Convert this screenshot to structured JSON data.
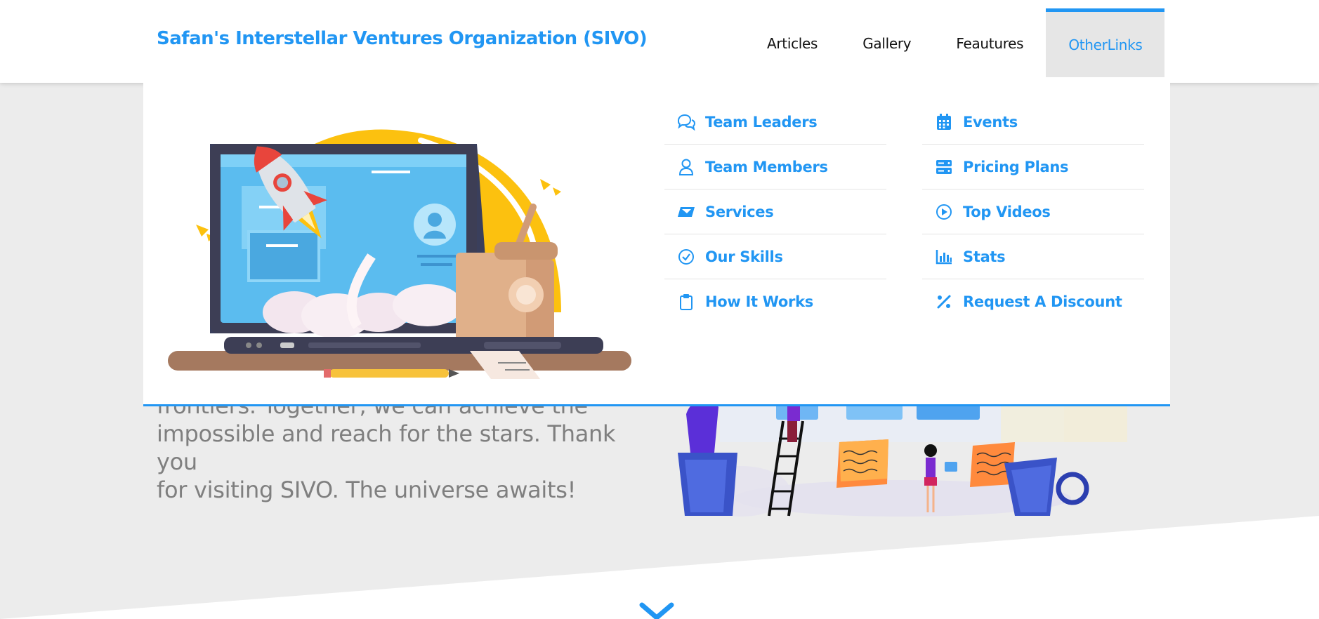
{
  "brand": "Safan's Interstellar Ventures Organization (SIVO)",
  "nav": {
    "items": [
      "Articles",
      "Gallery",
      "Feautures",
      "OtherLinks"
    ],
    "active": "OtherLinks"
  },
  "dropdown": {
    "column1": [
      {
        "label": "Team Leaders",
        "icon": "chat-bubbles-icon"
      },
      {
        "label": "Team Members",
        "icon": "user-icon"
      },
      {
        "label": "Services",
        "icon": "postal-envelope-icon"
      },
      {
        "label": "Our Skills",
        "icon": "check-circle-icon"
      },
      {
        "label": "How It Works",
        "icon": "clipboard-icon"
      }
    ],
    "column2": [
      {
        "label": "Events",
        "icon": "calendar-icon"
      },
      {
        "label": "Pricing Plans",
        "icon": "server-icon"
      },
      {
        "label": "Top Videos",
        "icon": "play-circle-icon"
      },
      {
        "label": "Stats",
        "icon": "bar-chart-icon"
      },
      {
        "label": "Request A Discount",
        "icon": "percent-icon"
      }
    ]
  },
  "hero": {
    "text_lines": [
      "frontiers. Together, we can achieve the",
      "impossible and reach for the stars. Thank you",
      "for visiting SIVO. The universe awaits!"
    ]
  },
  "colors": {
    "accent": "#2196f3",
    "background": "#ececec",
    "nav_active_bg": "#e6e6e6",
    "hero_text": "#7f7f7f"
  },
  "icons": {
    "scroll_down": "chevron-down-icon"
  }
}
